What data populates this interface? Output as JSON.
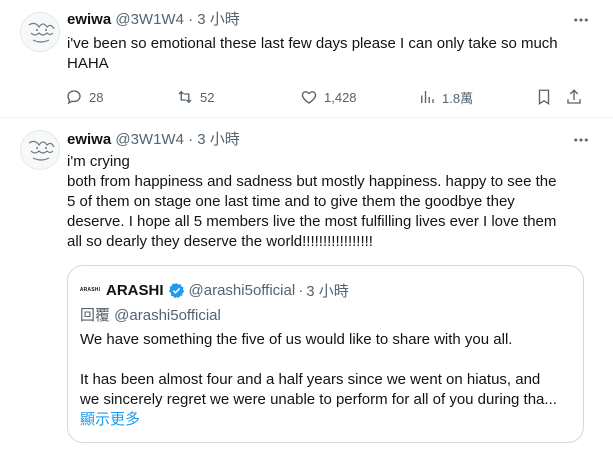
{
  "tweets": [
    {
      "author_name": "ewiwa",
      "handle": "@3W1W4",
      "separator": "·",
      "time": "3 小時",
      "text": "i've been so emotional these last few days please I can only take so much\nHAHA",
      "stats": {
        "replies": "28",
        "retweets": "52",
        "likes": "1,428",
        "views": "1.8萬"
      }
    },
    {
      "author_name": "ewiwa",
      "handle": "@3W1W4",
      "separator": "·",
      "time": "3 小時",
      "text": "i'm crying\nboth from happiness and sadness but mostly happiness. happy to see the\n5 of them on stage one last time and to give them the goodbye they\ndeserve. I hope all 5 members live the most fulfilling lives ever I love them\nall so dearly they deserve the world!!!!!!!!!!!!!!!!!",
      "quote": {
        "logo_text": "ARASHI",
        "author_name": "ARASHI",
        "handle": "@arashi5official",
        "separator": "·",
        "time": "3 小時",
        "reply_to": "回覆 @arashi5official",
        "line1": "We have something the five of us would like to share with you all.",
        "line2": "It has been almost four and a half years since we went on hiatus, and",
        "line3": "we sincerely regret we were unable to perform for all of you during tha...",
        "show_more": "顯示更多"
      }
    }
  ],
  "icons": {
    "more": "more-dots-icon",
    "reply": "reply-icon",
    "retweet": "retweet-icon",
    "like": "heart-icon",
    "views": "views-icon",
    "bookmark": "bookmark-icon",
    "share": "share-icon",
    "verified": "verified-badge-icon"
  },
  "colors": {
    "text": "#0f1419",
    "secondary": "#536471",
    "link": "#1d9bf0",
    "border": "#cfd9de",
    "divider": "#eff3f4"
  }
}
